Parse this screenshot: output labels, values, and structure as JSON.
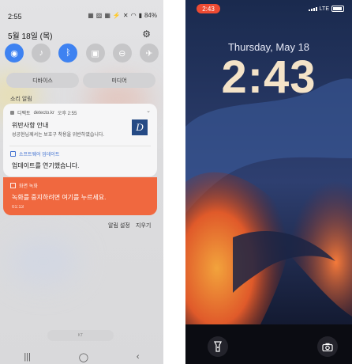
{
  "android": {
    "status": {
      "time": "2:55",
      "icons": [
        "icon-calendar",
        "icon-image",
        "icon-calendar",
        "icon-bolt",
        "icon-mute",
        "icon-wifi",
        "icon-signal"
      ],
      "battery": "84%"
    },
    "date": "5월 18일 (목)",
    "quick_settings": [
      {
        "icon": "wifi-icon",
        "glyph": "📶",
        "on": true
      },
      {
        "icon": "mute-icon",
        "glyph": "🔇",
        "on": false
      },
      {
        "icon": "bluetooth-icon",
        "glyph": "ᛒ",
        "on": true
      },
      {
        "icon": "portrait-lock-icon",
        "glyph": "▣",
        "on": false
      },
      {
        "icon": "do-not-disturb-icon",
        "glyph": "⊖",
        "on": false
      },
      {
        "icon": "airplane-icon",
        "glyph": "✈",
        "on": false
      }
    ],
    "device_button": "디바이스",
    "media_button": "미디어",
    "section_label": "소리 알림",
    "notification": {
      "app_name": "디팩토",
      "source": "detecto.kr",
      "time": "오후 2:55",
      "title": "위반사항 안내",
      "body": "성공현님께서는 보호구 착용을 위반하였습니다.",
      "logo_letter": "D",
      "software_app": "소프트웨어 업데이트",
      "software_msg": "업데이트를 연기했습니다."
    },
    "recording": {
      "app_name": "화면 녹화",
      "message": "녹화를 중지하려면 여기를 누르세요.",
      "elapsed": "01:13"
    },
    "actions": {
      "settings": "알림 설정",
      "clear": "지우기"
    },
    "home_hint": "KT",
    "nav": {
      "recents": "|||",
      "home": "◯",
      "back": "‹"
    }
  },
  "iphone": {
    "status_time": "2:43",
    "network": "LTE",
    "date": "Thursday, May 18",
    "clock": "2:43",
    "flashlight_icon": "flashlight-icon",
    "camera_icon": "camera-icon"
  },
  "colors": {
    "android_accent": "#3e82f1",
    "recording_orange": "#f0683f",
    "iphone_pill": "#ee4b33",
    "clock_color": "#f4e3c8"
  }
}
